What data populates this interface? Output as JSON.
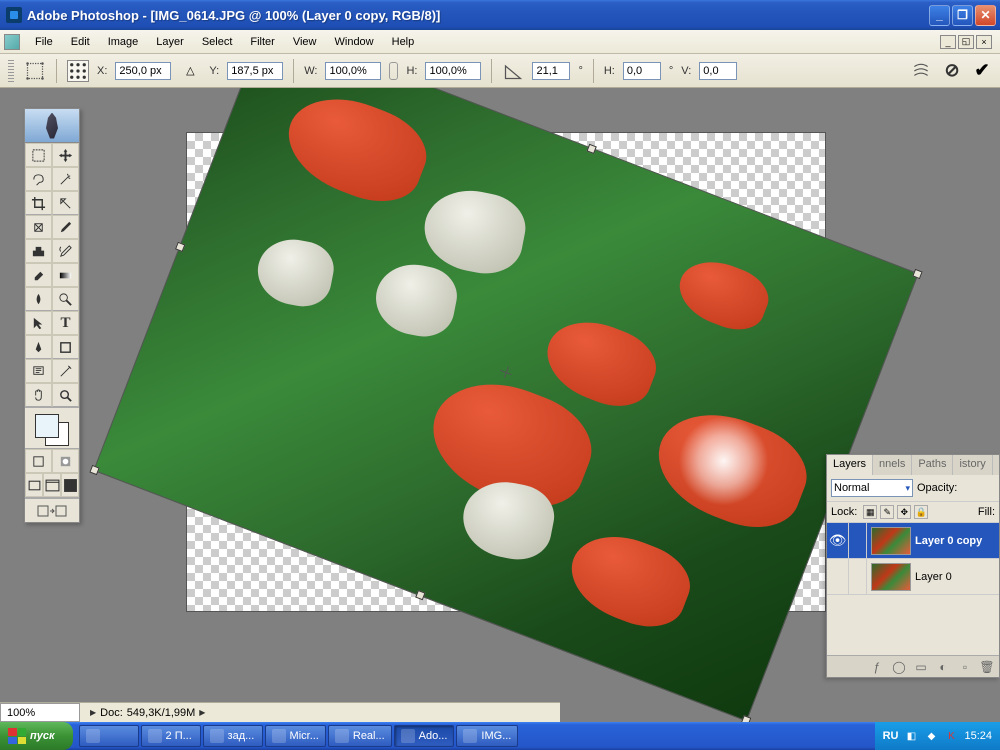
{
  "titlebar": {
    "title": "Adobe Photoshop - [IMG_0614.JPG @ 100% (Layer 0 copy, RGB/8)]"
  },
  "menu": {
    "items": [
      "File",
      "Edit",
      "Image",
      "Layer",
      "Select",
      "Filter",
      "View",
      "Window",
      "Help"
    ]
  },
  "options": {
    "x_label": "X:",
    "x_value": "250,0 px",
    "y_label": "Y:",
    "y_value": "187,5 px",
    "w_label": "W:",
    "w_value": "100,0%",
    "h_label": "H:",
    "h_value": "100,0%",
    "angle_value": "21,1",
    "angle_unit": "°",
    "hskew_label": "H:",
    "hskew_value": "0,0",
    "vskew_label": "V:",
    "vskew_value": "0,0"
  },
  "status": {
    "zoom": "100%",
    "doc_label": "Doc:",
    "doc_info": "549,3K/1,99M"
  },
  "layers_panel": {
    "tabs": [
      "Layers",
      "nnels",
      "Paths",
      "istory"
    ],
    "blend_mode": "Normal",
    "opacity_label": "Opacity:",
    "lock_label": "Lock:",
    "fill_label": "Fill:",
    "layers": [
      {
        "name": "Layer 0 copy",
        "visible": true,
        "selected": true
      },
      {
        "name": "Layer 0",
        "visible": false,
        "selected": false
      }
    ]
  },
  "taskbar": {
    "start": "пуск",
    "items": [
      "",
      "2 П...",
      "зад...",
      "Micr...",
      "Real...",
      "Ado...",
      "IMG..."
    ],
    "lang": "RU",
    "time": "15:24"
  }
}
